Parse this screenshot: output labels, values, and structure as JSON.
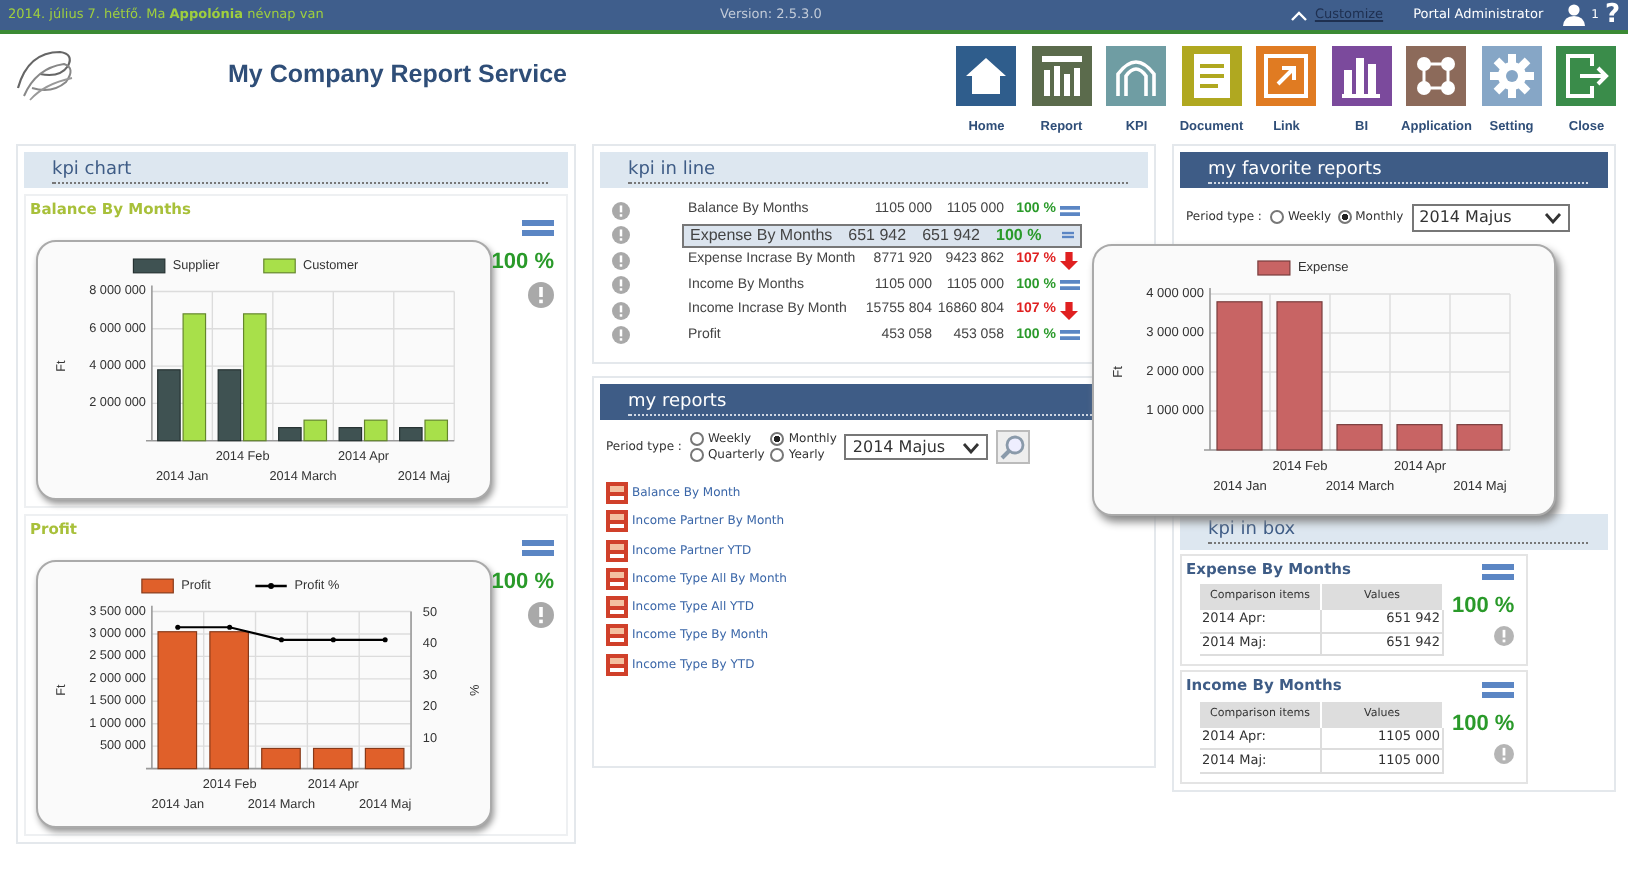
{
  "top_bar": {
    "date_text": "2014. július 7. hétfő. Ma **Appolónia** névnap van",
    "version": "Version: 2.5.3.0",
    "customize_link": "Customize",
    "user": "Portal Administrator",
    "notification_count": "1",
    "help_icon": "?"
  },
  "header": {
    "title": "My Company Report Service",
    "nav": [
      {
        "label": "Home",
        "kind": "home"
      },
      {
        "label": "Report",
        "kind": "report"
      },
      {
        "label": "KPI",
        "kind": "kpi"
      },
      {
        "label": "Document",
        "kind": "document"
      },
      {
        "label": "Link",
        "kind": "link"
      },
      {
        "label": "BI",
        "kind": "bi"
      },
      {
        "label": "Application",
        "kind": "application"
      },
      {
        "label": "Setting",
        "kind": "setting"
      },
      {
        "label": "Close",
        "kind": "close"
      }
    ]
  },
  "kpi_chart": {
    "title": "kpi chart",
    "items": [
      {
        "title": "Balance By Months",
        "percent": "100 %",
        "kind": "equal",
        "chart_data": {
          "type": "bar",
          "grid": true,
          "legend": "top",
          "ylabel": "Ft",
          "categories": [
            "2014 Jan",
            "2014 Feb",
            "2014 March",
            "2014 Apr",
            "2014 Maj"
          ],
          "ylim": [
            0,
            8000000
          ],
          "yticks": [
            {
              "value": 2000000,
              "label": "2 000 000"
            },
            {
              "value": 4000000,
              "label": "4 000 000"
            },
            {
              "value": 6000000,
              "label": "6 000 000"
            },
            {
              "value": 8000000,
              "label": "8 000 000"
            }
          ],
          "series": [
            {
              "name": "Supplier",
              "color": "#3f5252",
              "values": [
                3800000,
                3800000,
                700000,
                700000,
                700000
              ]
            },
            {
              "name": "Customer",
              "color": "#a8e04a",
              "values": [
                6800000,
                6800000,
                1100000,
                1100000,
                1100000
              ]
            }
          ]
        }
      },
      {
        "title": "Profit",
        "percent": "100 %",
        "kind": "equal",
        "chart_data": {
          "type": "bar",
          "grid": true,
          "legend": "top",
          "ylabel": "Ft",
          "y2label": "%",
          "categories": [
            "2014 Jan",
            "2014 Feb",
            "2014 March",
            "2014 Apr",
            "2014 Maj"
          ],
          "ylim": [
            0,
            3500000
          ],
          "yticks": [
            {
              "value": 500000,
              "label": "500 000"
            },
            {
              "value": 1000000,
              "label": "1 000 000"
            },
            {
              "value": 1500000,
              "label": "1 500 000"
            },
            {
              "value": 2000000,
              "label": "2 000 000"
            },
            {
              "value": 2500000,
              "label": "2 500 000"
            },
            {
              "value": 3000000,
              "label": "3 000 000"
            },
            {
              "value": 3500000,
              "label": "3 500 000"
            }
          ],
          "y2lim": [
            0,
            50
          ],
          "y2ticks": [
            10,
            20,
            30,
            40,
            50
          ],
          "series": [
            {
              "name": "Profit",
              "color": "#e0602a",
              "values": [
                3050000,
                3050000,
                450000,
                450000,
                450000
              ]
            },
            {
              "name": "Profit %",
              "color": "#000000",
              "type": "line",
              "axis": "y2",
              "values": [
                45,
                45,
                41,
                41,
                41
              ]
            }
          ]
        }
      }
    ]
  },
  "kpi_in_line": {
    "title": "kpi in line",
    "rows": [
      {
        "name": "Balance By Months",
        "value_1": "1105 000",
        "value_2": "1105 000",
        "percent": "100 %",
        "kind": "equal",
        "selected": false
      },
      {
        "name": "Expense By Months",
        "value_1": "651 942",
        "value_2": "651 942",
        "percent": "100 %",
        "kind": "equal",
        "selected": true
      },
      {
        "name": "Expense Incrase By Month",
        "value_1": "8771 920",
        "value_2": "9423 862",
        "percent": "107 %",
        "kind": "down",
        "selected": false
      },
      {
        "name": "Income By Months",
        "value_1": "1105 000",
        "value_2": "1105 000",
        "percent": "100 %",
        "kind": "equal",
        "selected": false
      },
      {
        "name": "Income Incrase By Month",
        "value_1": "15755 804",
        "value_2": "16860 804",
        "percent": "107 %",
        "kind": "down",
        "selected": false
      },
      {
        "name": "Profit",
        "value_1": "453 058",
        "value_2": "453 058",
        "percent": "100 %",
        "kind": "equal",
        "selected": false
      }
    ]
  },
  "my_reports": {
    "title": "my reports",
    "period_label": "Period type :",
    "periods": [
      {
        "label": "Weekly",
        "selected": false
      },
      {
        "label": "Monthly",
        "selected": true
      },
      {
        "label": "Quarterly",
        "selected": false
      },
      {
        "label": "Yearly",
        "selected": false
      }
    ],
    "period_value": "2014 Majus",
    "reports": [
      "Balance By Month",
      "Income Partner By Month",
      "Income Partner YTD",
      "Income Type All By Month",
      "Income Type All YTD",
      "Income Type By Month",
      "Income Type By YTD"
    ]
  },
  "favorite_reports": {
    "title": "my favorite reports",
    "period_label": "Period type :",
    "periods": [
      {
        "label": "Weekly",
        "selected": false
      },
      {
        "label": "Monthly",
        "selected": true
      }
    ],
    "period_value": "2014 Majus",
    "popup_chart": {
      "chart_data": {
        "type": "bar",
        "grid": true,
        "legend": "top",
        "ylabel": "Ft",
        "categories": [
          "2014 Jan",
          "2014 Feb",
          "2014 March",
          "2014 Apr",
          "2014 Maj"
        ],
        "ylim": [
          0,
          4000000
        ],
        "yticks": [
          {
            "value": 1000000,
            "label": "1 000 000"
          },
          {
            "value": 2000000,
            "label": "2 000 000"
          },
          {
            "value": 3000000,
            "label": "3 000 000"
          },
          {
            "value": 4000000,
            "label": "4 000 000"
          }
        ],
        "series": [
          {
            "name": "Expense",
            "color": "#c86464",
            "values": [
              3800000,
              3800000,
              650000,
              650000,
              650000
            ]
          }
        ]
      }
    }
  },
  "kpi_in_box": {
    "title": "kpi in box",
    "boxes": [
      {
        "title": "Expense By Months",
        "percent": "100 %",
        "kind": "equal",
        "columns": [
          "Comparison items",
          "Values"
        ],
        "rows": [
          {
            "label": "2014 Apr:",
            "value": "651 942"
          },
          {
            "label": "2014 Maj:",
            "value": "651 942"
          }
        ]
      },
      {
        "title": "Income By Months",
        "percent": "100 %",
        "kind": "equal",
        "columns": [
          "Comparison items",
          "Values"
        ],
        "rows": [
          {
            "label": "2014 Apr:",
            "value": "1105 000"
          },
          {
            "label": "2014 Maj:",
            "value": "1105 000"
          }
        ]
      }
    ]
  }
}
